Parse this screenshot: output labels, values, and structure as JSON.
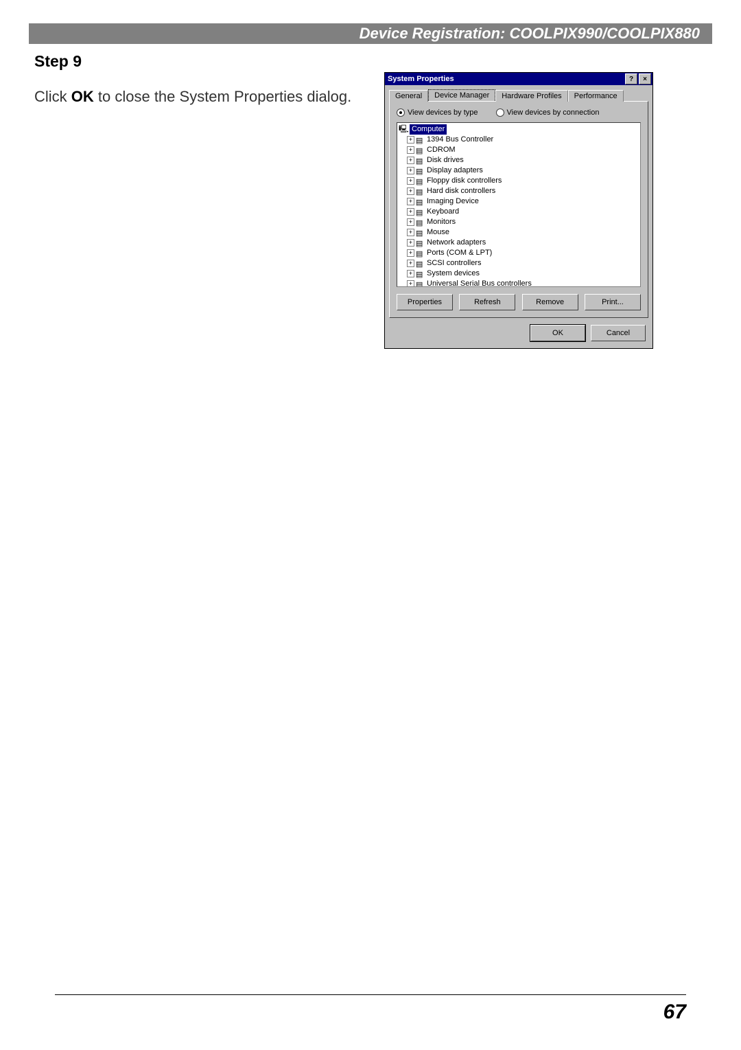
{
  "header": {
    "title": "Device Registration: COOLPIX990/COOLPIX880"
  },
  "step": {
    "heading": "Step 9"
  },
  "body": {
    "pre": "Click ",
    "bold": "OK",
    "post": " to close the System Properties dialog."
  },
  "dialog": {
    "title": "System Properties",
    "help_glyph": "?",
    "close_glyph": "×",
    "tabs": [
      "General",
      "Device Manager",
      "Hardware Profiles",
      "Performance"
    ],
    "selected_tab": 1,
    "radio_type": "View devices by type",
    "radio_conn": "View devices by connection",
    "tree_root": "Computer",
    "tree_items": [
      "1394 Bus Controller",
      "CDROM",
      "Disk drives",
      "Display adapters",
      "Floppy disk controllers",
      "Hard disk controllers",
      "Imaging Device",
      "Keyboard",
      "Monitors",
      "Mouse",
      "Network adapters",
      "Ports (COM & LPT)",
      "SCSI controllers",
      "System devices",
      "Universal Serial Bus controllers"
    ],
    "btn_properties": "Properties",
    "btn_refresh": "Refresh",
    "btn_remove": "Remove",
    "btn_print": "Print...",
    "btn_ok": "OK",
    "btn_cancel": "Cancel"
  },
  "page_number": "67"
}
